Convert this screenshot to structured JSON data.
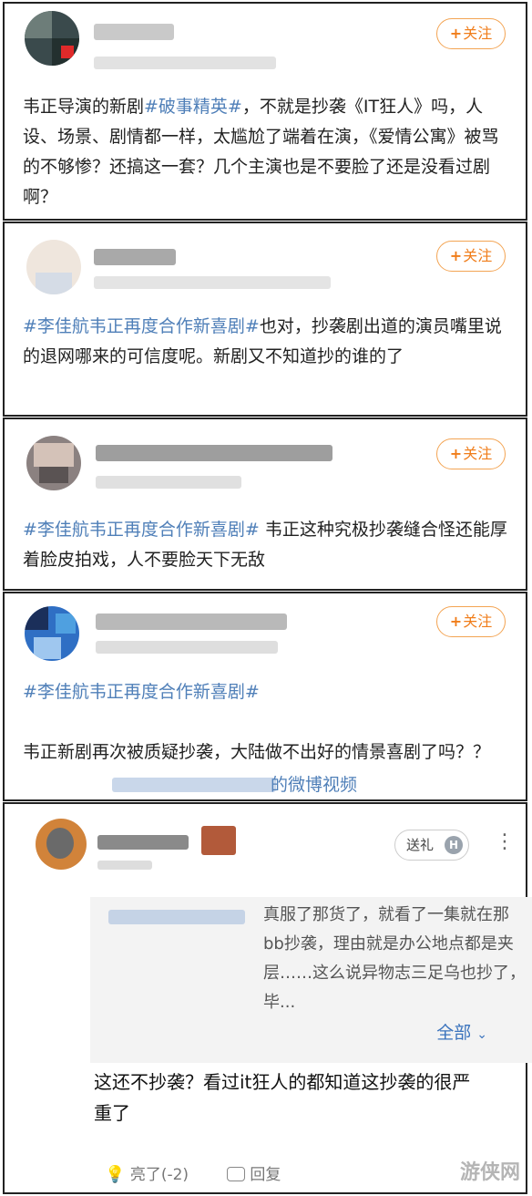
{
  "posts": [
    {
      "follow_label": "关注",
      "segments": [
        {
          "t": "韦正导演的新剧",
          "tag": false
        },
        {
          "t": "#破事精英#",
          "tag": true
        },
        {
          "t": "，不就是抄袭《IT狂人》吗，人设、场景、剧情都一样，太尴尬了端着在演，《爱情公寓》被骂的不够惨？还搞这一套？几个主演也是不要脸了还是没看过剧啊？",
          "tag": false
        }
      ]
    },
    {
      "follow_label": "关注",
      "segments": [
        {
          "t": "#李佳航韦正再度合作新喜剧#",
          "tag": true
        },
        {
          "t": "也对，抄袭剧出道的演员嘴里说的退网哪来的可信度呢。新剧又不知道抄的谁的了",
          "tag": false
        }
      ]
    },
    {
      "follow_label": "关注",
      "segments": [
        {
          "t": "#李佳航韦正再度合作新喜剧#",
          "tag": true
        },
        {
          "t": " 韦正这种究极抄袭缝合怪还能厚着脸皮拍戏，人不要脸天下无敌",
          "tag": false
        }
      ]
    },
    {
      "follow_label": "关注",
      "hashtag": "#李佳航韦正再度合作新喜剧#",
      "body": "韦正新剧再次被质疑抄袭，大陆做不出好的情景喜剧了吗？？",
      "video_link": "的微博视频"
    }
  ],
  "comment": {
    "gift_label": "送礼",
    "gift_badge": "H",
    "more_icon": "more-vertical-icon",
    "quote_text": "真服了那货了，就看了一集就在那bb抄袭，理由就是办公地点都是夹层……这么说异物志三足乌也抄了，毕...",
    "quote_more": "全部",
    "body": "这还不抄袭？看过it狂人的都知道这抄袭的很严重了",
    "like_label": "亮了(-2)",
    "reply_label": "回复"
  },
  "watermark": "游侠网",
  "colors": {
    "accent_orange": "#f07d1a",
    "hashtag_blue": "#4f7fb8",
    "link_blue": "#3a73bd"
  }
}
